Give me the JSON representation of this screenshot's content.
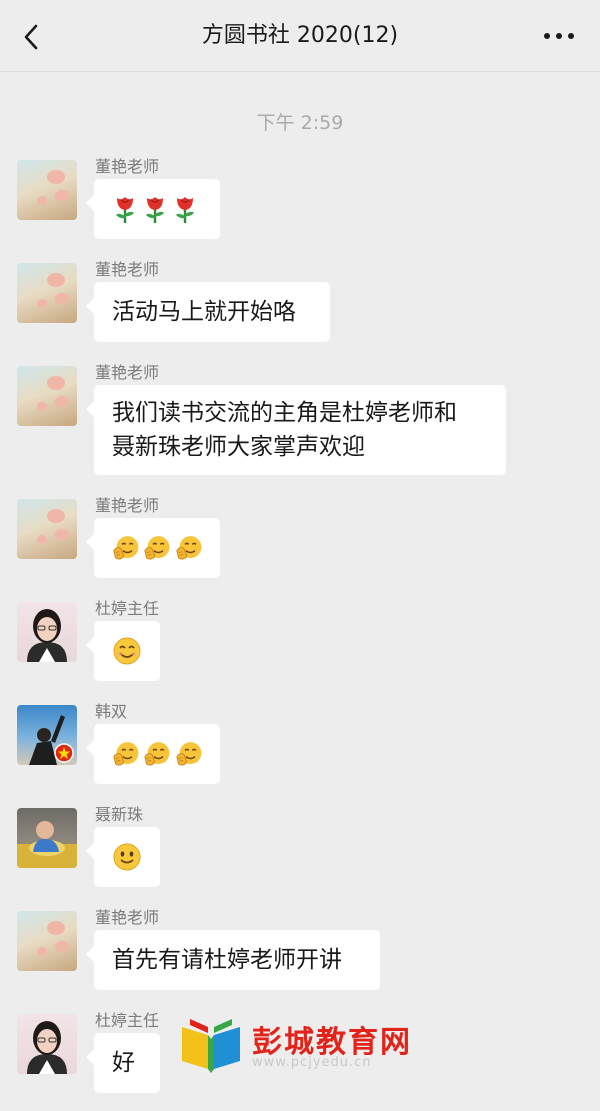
{
  "header": {
    "title": "方圆书社 2020(12)"
  },
  "timestamp": "下午 2:59",
  "messages": [
    {
      "sender": "董艳老师",
      "content": "",
      "emoji": [
        "rose-emoji",
        "rose-emoji",
        "rose-emoji"
      ]
    },
    {
      "sender": "董艳老师",
      "content": "活动马上就开始咯"
    },
    {
      "sender": "董艳老师",
      "content_line1": "我们读书交流的主角是杜婷老师和",
      "content_line2": "聂新珠老师大家掌声欢迎"
    },
    {
      "sender": "董艳老师",
      "content": "",
      "emoji": [
        "clapping-face-emoji",
        "clapping-face-emoji",
        "clapping-face-emoji"
      ]
    },
    {
      "sender": "杜婷主任",
      "content": "",
      "emoji": [
        "smile-emoji"
      ]
    },
    {
      "sender": "韩双",
      "content": "",
      "emoji": [
        "clapping-face-emoji",
        "clapping-face-emoji",
        "clapping-face-emoji"
      ]
    },
    {
      "sender": "聂新珠",
      "content": "",
      "emoji": [
        "slight-smile-emoji"
      ]
    },
    {
      "sender": "董艳老师",
      "content": "首先有请杜婷老师开讲"
    },
    {
      "sender": "杜婷主任",
      "content": "好"
    }
  ],
  "watermark": {
    "name": "彭城教育网",
    "url": "www.pcjyedu.cn"
  },
  "colors": {
    "background": "#ededed",
    "bubble": "#ffffff",
    "text": "#191919",
    "watermark": "#e2231a"
  }
}
